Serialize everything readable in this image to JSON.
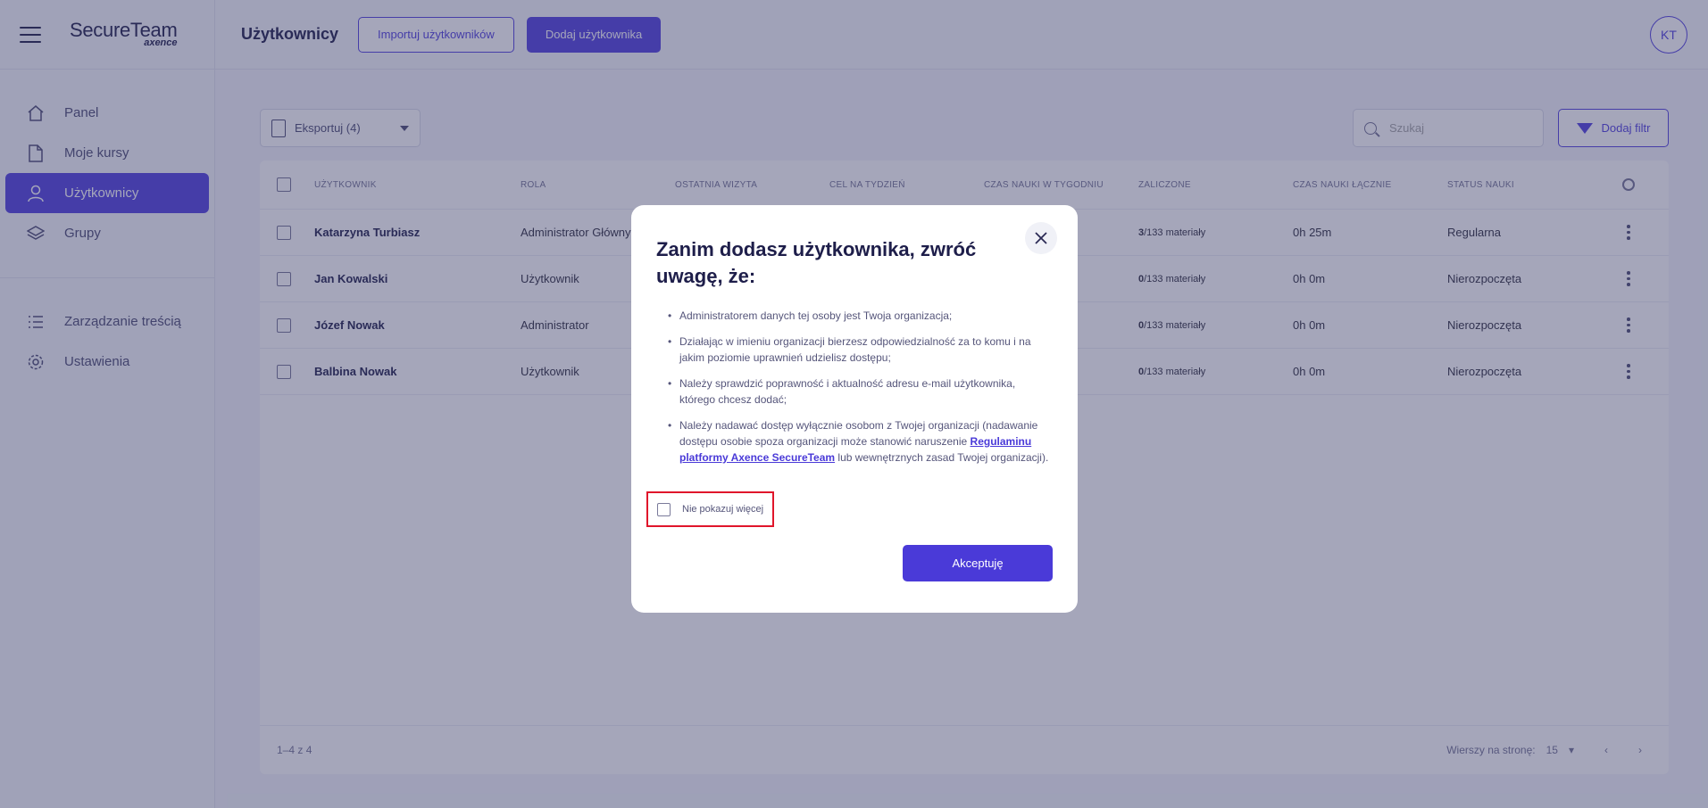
{
  "app": {
    "logo_main": "SecureTeam",
    "logo_sub": "axence"
  },
  "sidebar": {
    "items": [
      {
        "label": "Panel",
        "icon": "home-icon"
      },
      {
        "label": "Moje kursy",
        "icon": "document-icon"
      },
      {
        "label": "Użytkownicy",
        "icon": "user-icon",
        "active": true
      },
      {
        "label": "Grupy",
        "icon": "stack-icon"
      }
    ],
    "items2": [
      {
        "label": "Zarządzanie treścią",
        "icon": "list-icon"
      },
      {
        "label": "Ustawienia",
        "icon": "gear-icon"
      }
    ]
  },
  "header": {
    "title": "Użytkownicy",
    "import_label": "Importuj użytkowników",
    "add_label": "Dodaj użytkownika",
    "avatar_initials": "KT"
  },
  "toolbar": {
    "export_label": "Eksportuj (4)",
    "search_placeholder": "Szukaj",
    "filter_label": "Dodaj filtr"
  },
  "table": {
    "headers": [
      "Użytkownik",
      "Rola",
      "Ostatnia wizyta",
      "Cel na tydzień",
      "Czas nauki w tygodniu",
      "Zaliczone",
      "Czas nauki łącznie",
      "Status nauki"
    ],
    "rows": [
      {
        "name": "Katarzyna Turbiasz",
        "role": "Administrator Główny",
        "passed_count": "3",
        "passed_total": "/133 materiały",
        "time_total": "0h 25m",
        "status": "Regularna"
      },
      {
        "name": "Jan Kowalski",
        "role": "Użytkownik",
        "passed_count": "0",
        "passed_total": "/133 materiały",
        "time_total": "0h 0m",
        "status": "Nierozpoczęta"
      },
      {
        "name": "Józef Nowak",
        "role": "Administrator",
        "passed_count": "0",
        "passed_total": "/133 materiały",
        "time_total": "0h 0m",
        "status": "Nierozpoczęta"
      },
      {
        "name": "Balbina Nowak",
        "role": "Użytkownik",
        "passed_count": "0",
        "passed_total": "/133 materiały",
        "time_total": "0h 0m",
        "status": "Nierozpoczęta"
      }
    ],
    "footer": {
      "range": "1–4 z 4",
      "rows_per_page_label": "Wierszy na stronę:",
      "rows_per_page_value": "15"
    }
  },
  "modal": {
    "title": "Zanim dodasz użytkownika, zwróć uwagę, że:",
    "bullets": [
      "Administratorem danych tej osoby jest Twoja organizacja;",
      "Działając w imieniu organizacji bierzesz odpowiedzialność za to komu i na jakim poziomie uprawnień udzielisz dostępu;",
      "Należy sprawdzić poprawność i aktualność adresu e-mail użytkownika, którego chcesz dodać;"
    ],
    "bullet4_pre": "Należy nadawać dostęp wyłącznie osobom z Twojej organizacji (nadawanie dostępu osobie spoza organizacji może stanowić naruszenie ",
    "bullet4_link": "Regulaminu platformy Axence SecureTeam",
    "bullet4_post": " lub wewnętrznych zasad Twojej organizacji).",
    "dont_show_label": "Nie pokazuj więcej",
    "accept_label": "Akceptuję"
  },
  "colors": {
    "accent": "#5a4be0",
    "highlight_border": "#e0162b"
  }
}
